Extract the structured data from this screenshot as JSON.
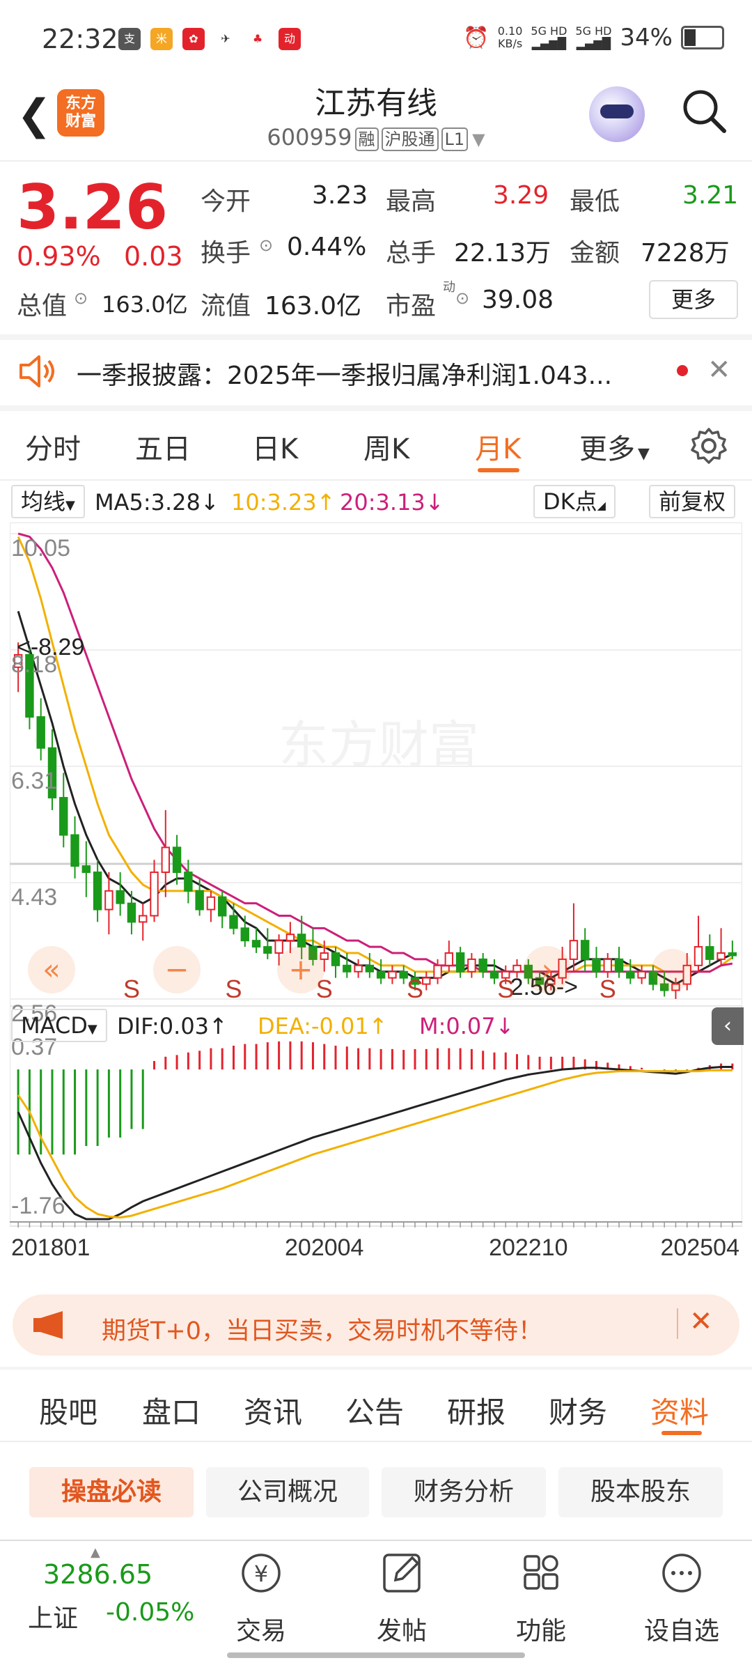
{
  "status_bar": {
    "time": "22:32",
    "net_speed": "0.10",
    "net_unit": "KB/s",
    "sig1": "5G HD",
    "sig2": "5G HD",
    "battery": "34%"
  },
  "header": {
    "logo": "东方\n财富",
    "title": "江苏有线",
    "code": "600959",
    "tags": [
      "融",
      "沪股通",
      "L1"
    ]
  },
  "quote": {
    "price": "3.26",
    "change_pct": "0.93%",
    "change": "0.03",
    "rows": [
      [
        {
          "label": "今开",
          "value": "3.23",
          "color": "normal"
        },
        {
          "label": "最高",
          "value": "3.29",
          "color": "red"
        },
        {
          "label": "最低",
          "value": "3.21",
          "color": "green"
        }
      ],
      [
        {
          "label": "换手",
          "value": "0.44%",
          "color": "normal"
        },
        {
          "label": "总手",
          "value": "22.13万",
          "color": "normal"
        },
        {
          "label": "金额",
          "value": "7228万",
          "color": "normal"
        }
      ],
      [
        {
          "label": "流值",
          "value": "163.0亿",
          "color": "normal"
        },
        {
          "label": "市盈",
          "value": "39.08",
          "color": "normal"
        }
      ]
    ],
    "total_value_label": "总值",
    "total_value": "163.0亿",
    "pe_superscript": "动",
    "more": "更多"
  },
  "notice": {
    "text": "一季报披露：2025年一季报归属净利润1.043..."
  },
  "period_tabs": [
    "分时",
    "五日",
    "日K",
    "周K",
    "月K",
    "更多"
  ],
  "active_period": "月K",
  "ma_line": {
    "toggle": "均线",
    "ma5": "MA5:3.28",
    "ma10": "10:3.23",
    "ma20": "20:3.13",
    "dk": "DK点",
    "adjust": "前复权"
  },
  "macd_line": {
    "toggle": "MACD",
    "dif": "DIF:0.03",
    "dea": "DEA:-0.01",
    "m": "M:0.07"
  },
  "chart_data": {
    "type": "candlestick",
    "watermark": "东方财富",
    "price_ticks": [
      "10.05",
      "8.18",
      "6.31",
      "4.43",
      "2.56"
    ],
    "price_ylim": [
      2.56,
      10.05
    ],
    "max_marker": "<-8.29",
    "min_marker": "2.56->",
    "macd_ticks": [
      "0.37",
      "-1.76"
    ],
    "macd_ylim": [
      -1.76,
      0.37
    ],
    "x_ticks": [
      "201801",
      "202004",
      "202210",
      "202504"
    ],
    "candles": [
      [
        7.9,
        8.3,
        7.5,
        8.1
      ],
      [
        8.1,
        8.2,
        6.9,
        7.1
      ],
      [
        7.1,
        7.4,
        6.4,
        6.6
      ],
      [
        6.6,
        6.9,
        5.6,
        5.8
      ],
      [
        5.8,
        6.2,
        5.0,
        5.2
      ],
      [
        5.2,
        5.5,
        4.5,
        4.7
      ],
      [
        4.7,
        5.1,
        4.2,
        4.6
      ],
      [
        4.6,
        4.8,
        3.8,
        4.0
      ],
      [
        4.0,
        4.6,
        3.6,
        4.3
      ],
      [
        4.3,
        4.6,
        3.9,
        4.1
      ],
      [
        4.1,
        4.3,
        3.6,
        3.8
      ],
      [
        3.8,
        4.1,
        3.5,
        3.9
      ],
      [
        3.9,
        4.8,
        3.8,
        4.6
      ],
      [
        4.6,
        5.6,
        4.2,
        5.0
      ],
      [
        5.0,
        5.2,
        4.4,
        4.6
      ],
      [
        4.6,
        4.8,
        4.1,
        4.3
      ],
      [
        4.3,
        4.5,
        3.9,
        4.0
      ],
      [
        4.0,
        4.3,
        3.8,
        4.2
      ],
      [
        4.2,
        4.3,
        3.7,
        3.9
      ],
      [
        3.9,
        4.1,
        3.6,
        3.7
      ],
      [
        3.7,
        3.9,
        3.4,
        3.5
      ],
      [
        3.5,
        3.7,
        3.3,
        3.4
      ],
      [
        3.4,
        3.7,
        3.2,
        3.3
      ],
      [
        3.3,
        3.6,
        3.1,
        3.5
      ],
      [
        3.5,
        3.8,
        3.3,
        3.6
      ],
      [
        3.6,
        3.9,
        3.2,
        3.4
      ],
      [
        3.4,
        3.7,
        3.1,
        3.2
      ],
      [
        3.2,
        3.5,
        3.0,
        3.3
      ],
      [
        3.3,
        3.4,
        2.9,
        3.1
      ],
      [
        3.1,
        3.3,
        2.9,
        3.0
      ],
      [
        3.0,
        3.2,
        2.9,
        3.1
      ],
      [
        3.1,
        3.3,
        2.9,
        3.0
      ],
      [
        3.0,
        3.2,
        2.8,
        2.9
      ],
      [
        2.9,
        3.1,
        2.8,
        3.0
      ],
      [
        3.0,
        3.1,
        2.8,
        2.9
      ],
      [
        2.9,
        3.0,
        2.7,
        2.8
      ],
      [
        2.8,
        3.0,
        2.7,
        2.9
      ],
      [
        2.9,
        3.2,
        2.8,
        3.1
      ],
      [
        3.1,
        3.5,
        3.0,
        3.3
      ],
      [
        3.3,
        3.4,
        2.9,
        3.0
      ],
      [
        3.0,
        3.3,
        2.9,
        3.2
      ],
      [
        3.2,
        3.3,
        2.9,
        3.0
      ],
      [
        3.0,
        3.2,
        2.8,
        2.9
      ],
      [
        2.9,
        3.1,
        2.8,
        3.0
      ],
      [
        3.0,
        3.2,
        2.9,
        3.1
      ],
      [
        3.1,
        3.2,
        2.8,
        2.9
      ],
      [
        2.9,
        3.0,
        2.7,
        2.8
      ],
      [
        2.8,
        3.0,
        2.7,
        2.9
      ],
      [
        2.9,
        3.4,
        2.8,
        3.2
      ],
      [
        3.2,
        4.1,
        3.0,
        3.5
      ],
      [
        3.5,
        3.7,
        3.0,
        3.2
      ],
      [
        3.2,
        3.4,
        2.9,
        3.0
      ],
      [
        3.0,
        3.3,
        2.9,
        3.2
      ],
      [
        3.2,
        3.4,
        2.9,
        3.0
      ],
      [
        3.0,
        3.2,
        2.8,
        2.9
      ],
      [
        2.9,
        3.1,
        2.8,
        3.0
      ],
      [
        3.0,
        3.1,
        2.7,
        2.8
      ],
      [
        2.8,
        3.0,
        2.6,
        2.7
      ],
      [
        2.7,
        2.9,
        2.56,
        2.8
      ],
      [
        2.8,
        3.3,
        2.7,
        3.1
      ],
      [
        3.1,
        3.9,
        3.0,
        3.4
      ],
      [
        3.4,
        3.6,
        3.1,
        3.2
      ],
      [
        3.2,
        3.7,
        3.1,
        3.3
      ],
      [
        3.3,
        3.5,
        3.2,
        3.26
      ]
    ],
    "ma_series": [
      {
        "name": "MA5",
        "color": "#222222",
        "values": [
          8.8,
          8.2,
          7.6,
          7.0,
          6.3,
          5.7,
          5.2,
          4.8,
          4.5,
          4.4,
          4.2,
          4.1,
          4.2,
          4.4,
          4.5,
          4.5,
          4.4,
          4.3,
          4.2,
          4.0,
          3.8,
          3.7,
          3.5,
          3.5,
          3.5,
          3.5,
          3.4,
          3.4,
          3.3,
          3.2,
          3.1,
          3.1,
          3.0,
          3.0,
          3.0,
          2.9,
          2.9,
          2.9,
          3.0,
          3.0,
          3.1,
          3.1,
          3.1,
          3.0,
          3.0,
          3.0,
          3.0,
          2.9,
          3.0,
          3.1,
          3.2,
          3.2,
          3.2,
          3.2,
          3.1,
          3.0,
          3.0,
          2.9,
          2.8,
          2.9,
          3.0,
          3.1,
          3.2,
          3.28
        ]
      },
      {
        "name": "MA10",
        "color": "#f2b000",
        "values": [
          10.0,
          9.6,
          9.0,
          8.3,
          7.6,
          6.9,
          6.3,
          5.7,
          5.2,
          4.9,
          4.6,
          4.4,
          4.3,
          4.3,
          4.3,
          4.3,
          4.3,
          4.3,
          4.2,
          4.1,
          4.0,
          3.9,
          3.8,
          3.7,
          3.6,
          3.5,
          3.5,
          3.4,
          3.4,
          3.3,
          3.3,
          3.2,
          3.1,
          3.1,
          3.1,
          3.0,
          3.0,
          3.0,
          3.0,
          3.0,
          3.0,
          3.0,
          3.0,
          3.0,
          3.0,
          3.0,
          3.0,
          3.0,
          3.0,
          3.0,
          3.1,
          3.1,
          3.1,
          3.1,
          3.1,
          3.1,
          3.1,
          3.0,
          3.0,
          3.0,
          3.0,
          3.0,
          3.1,
          3.23
        ]
      },
      {
        "name": "MA20",
        "color": "#cc1f7a",
        "values": [
          10.05,
          10.0,
          9.8,
          9.5,
          9.1,
          8.6,
          8.1,
          7.6,
          7.1,
          6.6,
          6.1,
          5.7,
          5.3,
          5.0,
          4.8,
          4.6,
          4.5,
          4.4,
          4.3,
          4.2,
          4.1,
          4.1,
          4.0,
          3.9,
          3.9,
          3.8,
          3.7,
          3.7,
          3.6,
          3.5,
          3.5,
          3.4,
          3.4,
          3.3,
          3.3,
          3.2,
          3.2,
          3.1,
          3.1,
          3.1,
          3.1,
          3.0,
          3.0,
          3.0,
          3.0,
          3.0,
          3.0,
          3.0,
          3.0,
          3.0,
          3.0,
          3.0,
          3.0,
          3.0,
          3.0,
          3.0,
          3.0,
          3.0,
          3.0,
          3.0,
          3.0,
          3.0,
          3.1,
          3.13
        ]
      }
    ],
    "macd_hist": [
      -1.0,
      -1.0,
      -1.0,
      -1.0,
      -1.0,
      -1.0,
      -0.9,
      -0.9,
      -0.8,
      -0.8,
      -0.7,
      -0.7,
      0.1,
      0.15,
      0.17,
      0.2,
      0.22,
      0.25,
      0.25,
      0.28,
      0.3,
      0.3,
      0.32,
      0.33,
      0.33,
      0.33,
      0.32,
      0.3,
      0.28,
      0.27,
      0.25,
      0.25,
      0.24,
      0.24,
      0.23,
      0.24,
      0.24,
      0.25,
      0.25,
      0.25,
      0.24,
      0.22,
      0.2,
      0.2,
      0.18,
      0.17,
      0.15,
      0.15,
      0.15,
      0.15,
      0.12,
      0.1,
      0.08,
      0.06,
      0.04,
      0.02,
      0.0,
      -0.02,
      -0.02,
      -0.03,
      0.02,
      0.05,
      0.07,
      0.07
    ],
    "dif": [
      -0.5,
      -0.8,
      -1.1,
      -1.35,
      -1.55,
      -1.7,
      -1.76,
      -1.76,
      -1.76,
      -1.7,
      -1.62,
      -1.55,
      -1.5,
      -1.45,
      -1.4,
      -1.35,
      -1.3,
      -1.25,
      -1.2,
      -1.15,
      -1.1,
      -1.05,
      -1.0,
      -0.95,
      -0.9,
      -0.85,
      -0.8,
      -0.76,
      -0.72,
      -0.68,
      -0.64,
      -0.6,
      -0.56,
      -0.52,
      -0.48,
      -0.44,
      -0.4,
      -0.36,
      -0.32,
      -0.28,
      -0.24,
      -0.2,
      -0.16,
      -0.12,
      -0.09,
      -0.06,
      -0.04,
      -0.02,
      0.0,
      0.01,
      0.02,
      0.02,
      0.01,
      0.0,
      -0.01,
      -0.02,
      -0.03,
      -0.04,
      -0.05,
      -0.03,
      0.0,
      0.02,
      0.03,
      0.03
    ],
    "dea": [
      -0.3,
      -0.5,
      -0.8,
      -1.05,
      -1.3,
      -1.5,
      -1.62,
      -1.7,
      -1.73,
      -1.74,
      -1.72,
      -1.68,
      -1.64,
      -1.6,
      -1.56,
      -1.52,
      -1.48,
      -1.44,
      -1.4,
      -1.35,
      -1.3,
      -1.25,
      -1.2,
      -1.15,
      -1.1,
      -1.05,
      -1.0,
      -0.96,
      -0.92,
      -0.88,
      -0.84,
      -0.8,
      -0.76,
      -0.72,
      -0.68,
      -0.64,
      -0.6,
      -0.56,
      -0.52,
      -0.48,
      -0.44,
      -0.4,
      -0.36,
      -0.32,
      -0.28,
      -0.24,
      -0.2,
      -0.16,
      -0.12,
      -0.09,
      -0.06,
      -0.04,
      -0.03,
      -0.02,
      -0.02,
      -0.02,
      -0.02,
      -0.02,
      -0.02,
      -0.02,
      -0.02,
      -0.01,
      -0.01,
      -0.01
    ]
  },
  "chart_overlay": {
    "s_marks": [
      "S",
      "S",
      "S",
      "S",
      "S",
      "S"
    ],
    "zoom_out": "−",
    "zoom_in": "+"
  },
  "banner": {
    "text": "期货T+0，当日买卖，交易时机不等待！"
  },
  "bottom_tabs": [
    "股吧",
    "盘口",
    "资讯",
    "公告",
    "研报",
    "财务",
    "资料"
  ],
  "active_bottom_tab": "资料",
  "chips": [
    "操盘必读",
    "公司概况",
    "财务分析",
    "股本股东"
  ],
  "bottom_nav": {
    "index_value": "3286.65",
    "index_name": "上证",
    "index_change": "-0.05%",
    "items": [
      "交易",
      "发帖",
      "功能",
      "设自选"
    ]
  },
  "colors": {
    "accent": "#f36d22",
    "up": "#e3232c",
    "down": "#1a9a1a"
  }
}
